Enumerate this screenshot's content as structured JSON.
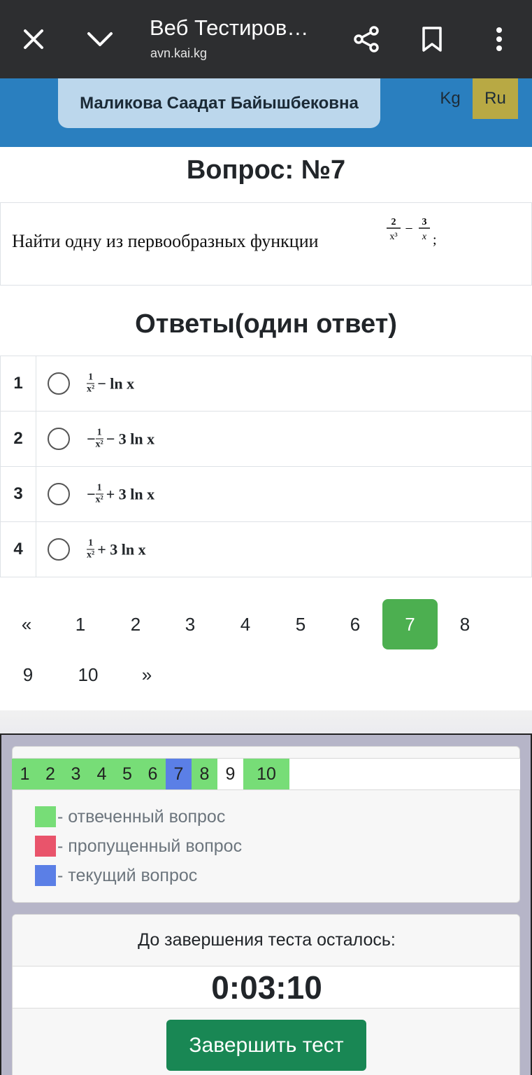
{
  "browser": {
    "title": "Веб Тестиров…",
    "url": "avn.kai.kg",
    "icons": [
      "close-icon",
      "chevron-down-icon",
      "share-icon",
      "bookmark-icon",
      "more-vert-icon"
    ]
  },
  "header": {
    "user_name": "Маликова Саадат Байышбековна",
    "lang_kg": "Kg",
    "lang_ru": "Ru",
    "active_lang": "Ru",
    "colors": {
      "bar": "#2a7fbf",
      "active_lang": "#b8a944"
    }
  },
  "question": {
    "heading": "Вопрос: №7",
    "text": "Найти одну из первообразных функции",
    "formula": {
      "t1_num": "2",
      "t1_den": "x³",
      "op": "−",
      "t2_num": "3",
      "t2_den": "x",
      "tail": ";"
    }
  },
  "answers": {
    "heading": "Ответы(один ответ)",
    "items": [
      {
        "num": "1",
        "sign": "",
        "frac_num": "1",
        "frac_den": "x²",
        "rest": "− ln x"
      },
      {
        "num": "2",
        "sign": "−",
        "frac_num": "1",
        "frac_den": "x²",
        "rest": "− 3 ln x"
      },
      {
        "num": "3",
        "sign": "−",
        "frac_num": "1",
        "frac_den": "x²",
        "rest": "+ 3 ln x"
      },
      {
        "num": "4",
        "sign": "",
        "frac_num": "1",
        "frac_den": "x²",
        "rest": "+ 3 ln x"
      }
    ]
  },
  "pagination": {
    "prev": "«",
    "next": "»",
    "pages": [
      "1",
      "2",
      "3",
      "4",
      "5",
      "6",
      "7",
      "8",
      "9",
      "10"
    ],
    "active": "7",
    "active_color": "#4caf50"
  },
  "question_nav": {
    "items": [
      {
        "label": "1",
        "status": "answered"
      },
      {
        "label": "2",
        "status": "answered"
      },
      {
        "label": "3",
        "status": "answered"
      },
      {
        "label": "4",
        "status": "answered"
      },
      {
        "label": "5",
        "status": "answered"
      },
      {
        "label": "6",
        "status": "answered"
      },
      {
        "label": "7",
        "status": "current"
      },
      {
        "label": "8",
        "status": "answered"
      },
      {
        "label": "9",
        "status": "none"
      },
      {
        "label": "10",
        "status": "answered"
      }
    ],
    "colors": {
      "answered": "#77dd77",
      "skipped": "#e9546b",
      "current": "#5b7fe6"
    },
    "legend": {
      "answered": "- отвеченный вопрос",
      "skipped": "- пропущенный вопрос",
      "current": "- текущий вопрос"
    }
  },
  "timer": {
    "label": "До завершения теста осталось:",
    "value": "0:03:10",
    "finish_button": "Завершить тест",
    "button_color": "#198754"
  }
}
